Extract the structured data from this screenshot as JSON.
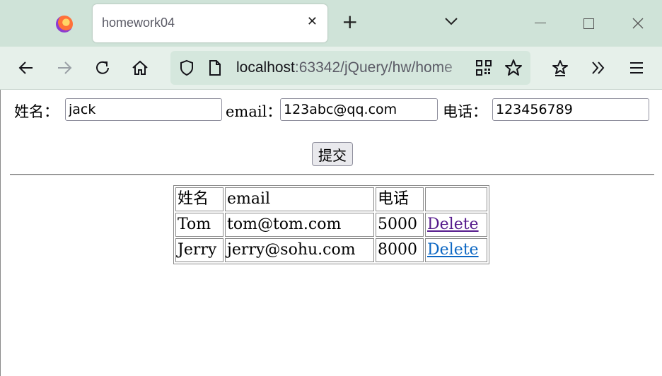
{
  "browser": {
    "tab_title": "homework04",
    "url_host": "localhost",
    "url_rest": ":63342/jQuery/hw/home",
    "icons": [
      "firefox-logo",
      "close-icon",
      "plus-icon",
      "chevron-down-icon",
      "minimize-icon",
      "maximize-icon",
      "close-window-icon",
      "back-arrow-icon",
      "forward-arrow-icon",
      "reload-icon",
      "home-icon",
      "shield-icon",
      "page-icon",
      "qr-code-icon",
      "star-icon",
      "extensions-icon",
      "overflow-icon",
      "menu-icon"
    ]
  },
  "form": {
    "name_label": "姓名：",
    "name_value": "jack",
    "email_label": "email：",
    "email_value": "123abc@qq.com",
    "phone_label": "电话：",
    "phone_value": "123456789",
    "submit_label": "提交"
  },
  "table": {
    "headers": [
      "姓名",
      "email",
      "电话",
      ""
    ],
    "rows": [
      {
        "name": "Tom",
        "email": "tom@tom.com",
        "phone": "5000",
        "action": "Delete"
      },
      {
        "name": "Jerry",
        "email": "jerry@sohu.com",
        "phone": "8000",
        "action": "Delete"
      }
    ]
  }
}
